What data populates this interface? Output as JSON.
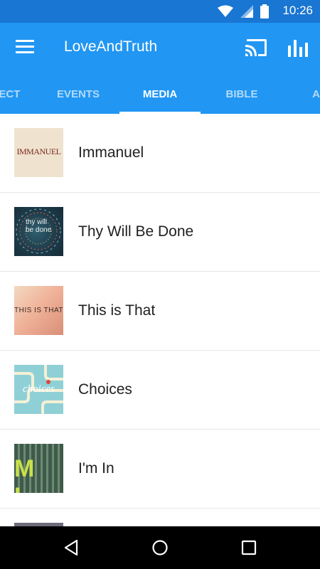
{
  "status_bar": {
    "time": "10:26",
    "icons": [
      "wifi-icon",
      "signal-icon",
      "battery-icon"
    ]
  },
  "app_bar": {
    "title": "LoveAndTruth",
    "background": "#2196F3"
  },
  "tabs": [
    {
      "label": "NECT"
    },
    {
      "label": "EVENTS"
    },
    {
      "label": "MEDIA",
      "active": true
    },
    {
      "label": "BIBLE"
    },
    {
      "label": "AB"
    }
  ],
  "media_list": [
    {
      "title": "Immanuel",
      "thumb_text": "IMMANUEL"
    },
    {
      "title": "Thy Will Be Done",
      "thumb_text": "thy will be done"
    },
    {
      "title": "This is That",
      "thumb_text": "THIS IS THAT"
    },
    {
      "title": "Choices",
      "thumb_text": "choices"
    },
    {
      "title": "I'm In",
      "thumb_text": "M I"
    },
    {
      "title": ""
    }
  ],
  "colors": {
    "status_bar": "#1976D2",
    "primary": "#2196F3",
    "text": "#212121"
  }
}
